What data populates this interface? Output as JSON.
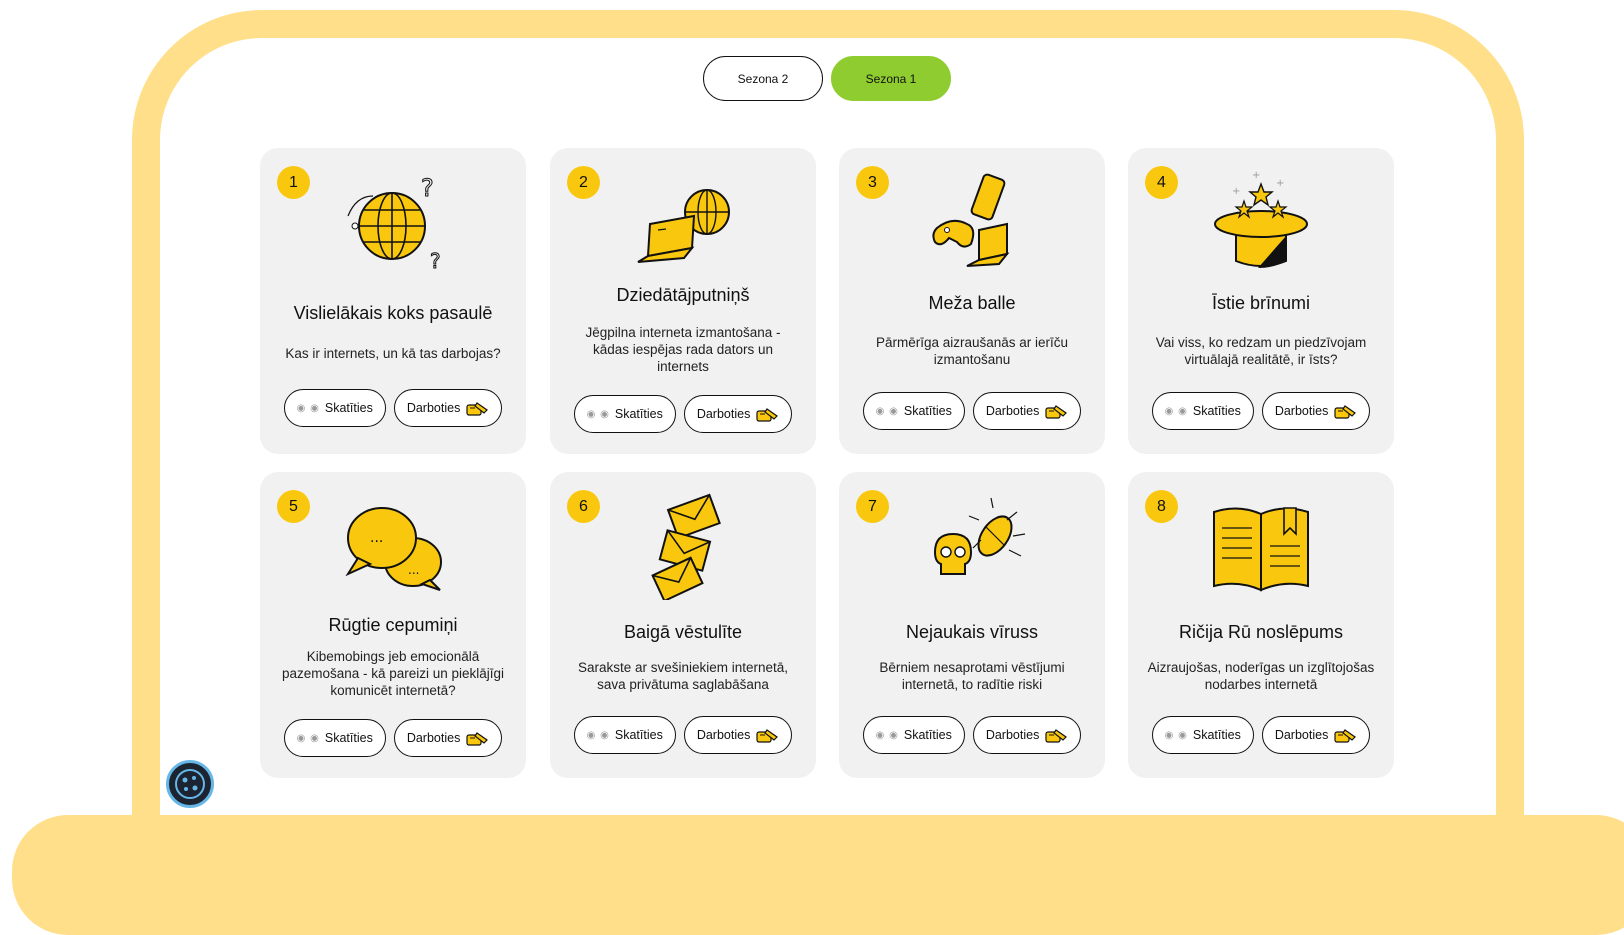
{
  "seasons": {
    "tabs": [
      {
        "label": "Sezona 2",
        "active": false
      },
      {
        "label": "Sezona 1",
        "active": true
      }
    ]
  },
  "colors": {
    "frame": "#ffdf8a",
    "accent": "#f9c80e",
    "active_tab": "#8fcc2f",
    "card": "#f1f1f1"
  },
  "episodes": [
    {
      "number": "1",
      "title": "Vislielākais koks pasaulē",
      "description": "Kas ir internets, un kā tas darbojas?",
      "icon": "globe-icon"
    },
    {
      "number": "2",
      "title": "Dziedātājputniņš",
      "description": "Jēgpilna interneta izmantošana - kādas iespējas rada dators un internets",
      "icon": "laptop-globe-icon"
    },
    {
      "number": "3",
      "title": "Meža balle",
      "description": "Pārmērīga aizraušanās ar ierīču izmantošanu",
      "icon": "devices-icon"
    },
    {
      "number": "4",
      "title": "Īstie brīnumi",
      "description": "Vai viss, ko redzam un piedzīvojam virtuālajā realitātē, ir īsts?",
      "icon": "magic-hat-icon"
    },
    {
      "number": "5",
      "title": "Rūgtie cepumiņi",
      "description": "Kibemobings jeb emocionālā pazemošana - kā pareizi un pieklājīgi komunicēt internetā?",
      "icon": "chat-bubbles-icon"
    },
    {
      "number": "6",
      "title": "Baigā vēstulīte",
      "description": "Sarakste ar svešiniekiem internetā, sava privātuma saglabāšana",
      "icon": "envelopes-icon"
    },
    {
      "number": "7",
      "title": "Nejaukais vīruss",
      "description": "Bērniem nesaprotami vēstījumi internetā, to radītie riski",
      "icon": "skull-bug-icon"
    },
    {
      "number": "8",
      "title": "Ričija Rū noslēpums",
      "description": "Aizraujošas, noderīgas un izglītojošas nodarbes internetā",
      "icon": "book-icon"
    }
  ],
  "actions": {
    "watch_label": "Skatīties",
    "watch_icon": "eyes-icon",
    "do_label": "Darboties",
    "do_icon": "hand-pencil-icon"
  },
  "cookie": {
    "icon": "cookie-icon"
  }
}
